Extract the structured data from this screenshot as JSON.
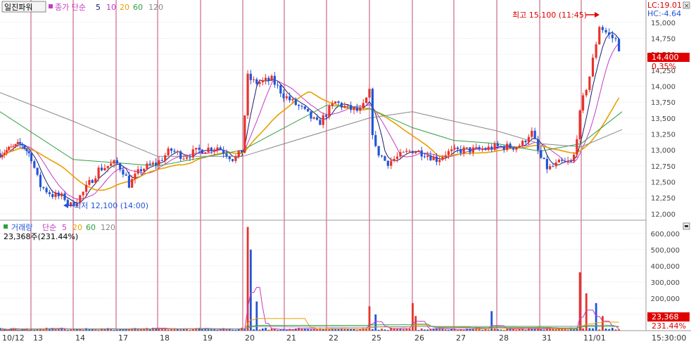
{
  "header": {
    "title": "일진파워",
    "ma_label": "종가 단순",
    "ma_periods": [
      "5",
      "10",
      "20",
      "60",
      "120"
    ],
    "lc": "LC:19.01",
    "hc": "HC:-4.64"
  },
  "volume_header": {
    "title": "거래량",
    "ma_label": "단순",
    "ma_periods": [
      "5",
      "20",
      "60",
      "120"
    ],
    "current": "23,368주(231.44%)"
  },
  "annotations": {
    "high": "최고 15,100 (11:45)",
    "low": "최저 12,100 (14:00)"
  },
  "price_badge": {
    "price": "14,400",
    "change": "0.35%"
  },
  "volume_badge": {
    "value": "23,368",
    "pct": "231.44%"
  },
  "time_label": "15:30:00",
  "colors": {
    "up": "#e8322a",
    "down": "#2255d6",
    "ma5": "#1a1a6e",
    "ma10": "#c43bc4",
    "ma20": "#e8a000",
    "ma60": "#2ea043",
    "ma120": "#888888",
    "divider": "#c24b6d",
    "grid": "#c8c8c8",
    "badge": "#e00000"
  },
  "chart_data": [
    {
      "type": "candlestick",
      "title": "일진파워",
      "ylim": [
        11900,
        15350
      ],
      "y_ticks": [
        "12,000",
        "12,250",
        "12,500",
        "12,750",
        "13,000",
        "13,250",
        "13,500",
        "13,750",
        "14,000",
        "14,250",
        "14,500",
        "14,750",
        "15,000"
      ],
      "y_tick_values": [
        12000,
        12250,
        12500,
        12750,
        13000,
        13250,
        13500,
        13750,
        14000,
        14250,
        14500,
        14750,
        15000
      ],
      "days": [
        "10/12",
        "13",
        "14",
        "17",
        "18",
        "19",
        "20",
        "21",
        "22",
        "25",
        "26",
        "27",
        "28",
        "31",
        "11/01"
      ],
      "current_price": 14400,
      "high": 15100,
      "low": 12100,
      "close_path": [
        [
          0,
          12950
        ],
        [
          0.5,
          13050
        ],
        [
          0.7,
          13100
        ],
        [
          1.0,
          12900
        ],
        [
          1.2,
          12450
        ],
        [
          1.5,
          12300
        ],
        [
          1.8,
          12250
        ],
        [
          1.9,
          12100
        ],
        [
          2.2,
          12300
        ],
        [
          2.6,
          12700
        ],
        [
          3.0,
          12800
        ],
        [
          3.2,
          12650
        ],
        [
          3.3,
          12450
        ],
        [
          3.6,
          12700
        ],
        [
          4.0,
          12800
        ],
        [
          4.3,
          13000
        ],
        [
          4.6,
          12900
        ],
        [
          5.0,
          13000
        ],
        [
          5.4,
          13050
        ],
        [
          5.8,
          12850
        ],
        [
          6.0,
          13000
        ],
        [
          6.1,
          14150
        ],
        [
          6.3,
          14050
        ],
        [
          6.7,
          14100
        ],
        [
          7.0,
          13850
        ],
        [
          7.4,
          13650
        ],
        [
          7.8,
          13400
        ],
        [
          8.2,
          13750
        ],
        [
          8.5,
          13650
        ],
        [
          8.8,
          13600
        ],
        [
          9.0,
          13900
        ],
        [
          9.1,
          13050
        ],
        [
          9.4,
          12800
        ],
        [
          9.7,
          12900
        ],
        [
          10.0,
          13000
        ],
        [
          10.3,
          12950
        ],
        [
          10.6,
          12850
        ],
        [
          10.8,
          12950
        ],
        [
          11.2,
          13000
        ],
        [
          11.6,
          13000
        ],
        [
          12.0,
          13050
        ],
        [
          12.4,
          13050
        ],
        [
          12.6,
          13100
        ],
        [
          12.8,
          13300
        ],
        [
          13.0,
          12900
        ],
        [
          13.2,
          12700
        ],
        [
          13.5,
          12800
        ],
        [
          13.8,
          12800
        ],
        [
          14.0,
          13700
        ],
        [
          14.2,
          14200
        ],
        [
          14.4,
          14950
        ],
        [
          14.6,
          14800
        ],
        [
          14.8,
          14700
        ],
        [
          14.9,
          14400
        ]
      ],
      "ma120": [
        [
          0,
          13900
        ],
        [
          2,
          13450
        ],
        [
          4,
          12900
        ],
        [
          6,
          12900
        ],
        [
          8,
          13300
        ],
        [
          9,
          13500
        ],
        [
          10,
          13600
        ],
        [
          11,
          13450
        ],
        [
          12,
          13300
        ],
        [
          13,
          13100
        ],
        [
          14,
          13050
        ],
        [
          14.9,
          13320
        ]
      ],
      "ma60": [
        [
          0,
          13600
        ],
        [
          2,
          12850
        ],
        [
          4,
          12750
        ],
        [
          6,
          13000
        ],
        [
          8,
          13700
        ],
        [
          9,
          13650
        ],
        [
          10,
          13350
        ],
        [
          11,
          13150
        ],
        [
          12,
          13100
        ],
        [
          13,
          12980
        ],
        [
          14,
          13100
        ],
        [
          14.9,
          13600
        ]
      ],
      "annotations": [
        "최고 15,100 (11:45)",
        "최저 12,100 (14:00)"
      ]
    },
    {
      "type": "bar",
      "title": "거래량",
      "ylim": [
        0,
        660000
      ],
      "y_ticks": [
        "100,000",
        "200,000",
        "300,000",
        "400,000",
        "500,000",
        "600,000"
      ],
      "y_tick_values": [
        100000,
        200000,
        300000,
        400000,
        500000,
        600000
      ],
      "spikes": [
        [
          6.1,
          640000
        ],
        [
          6.2,
          500000
        ],
        [
          6.35,
          180000
        ],
        [
          9.0,
          150000
        ],
        [
          9.15,
          100000
        ],
        [
          10.0,
          170000
        ],
        [
          10.05,
          90000
        ],
        [
          11.9,
          120000
        ],
        [
          14.0,
          360000
        ],
        [
          14.1,
          230000
        ],
        [
          14.3,
          170000
        ],
        [
          14.5,
          90000
        ]
      ],
      "current_volume": 23368
    }
  ]
}
